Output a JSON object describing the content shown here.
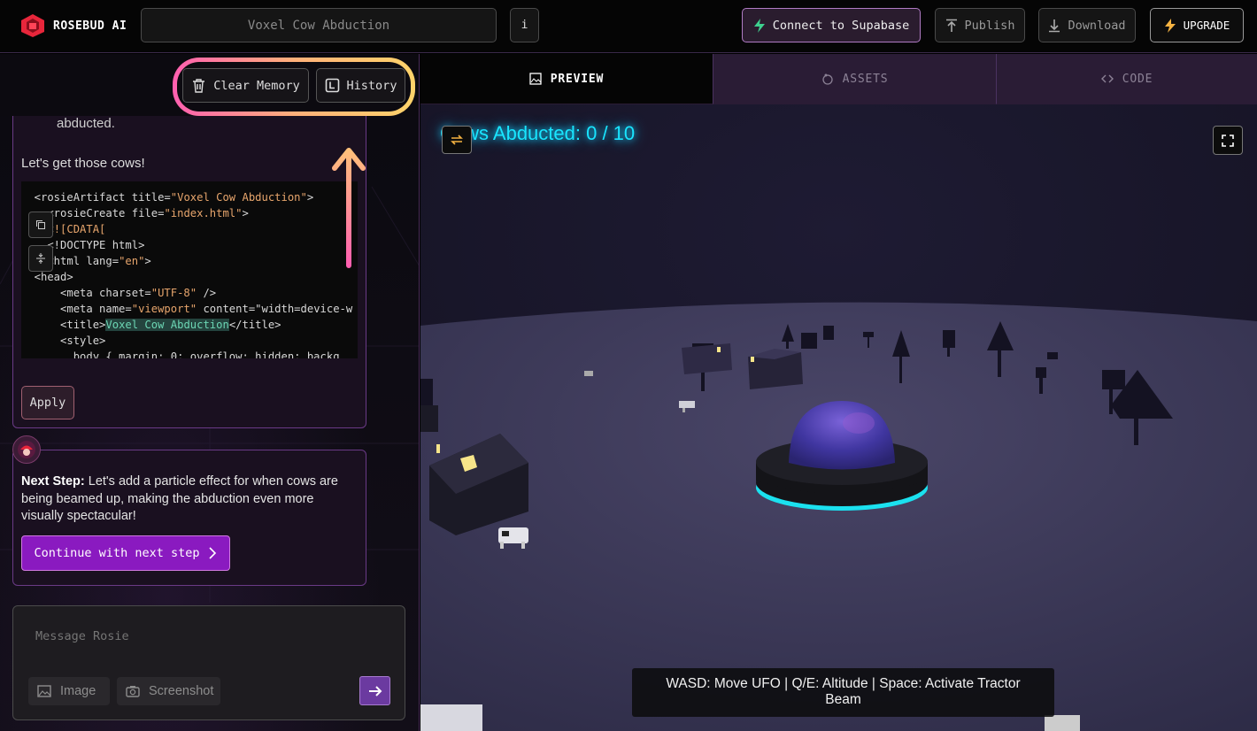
{
  "app": {
    "brand": "ROSEBUD AI",
    "project_title": "Voxel Cow Abduction",
    "info_label": "i"
  },
  "header": {
    "supabase_label": "Connect to Supabase",
    "publish_label": "Publish",
    "download_label": "Download",
    "upgrade_label": "UPGRADE"
  },
  "memory": {
    "clear_label": "Clear Memory",
    "history_label": "History"
  },
  "chat": {
    "abducted_text": "abducted.",
    "cta_text": "Let's get those cows!",
    "code_lines": [
      {
        "pre": "  <rosieArtifact title=",
        "str": "\"Voxel Cow Abduction\"",
        "post": ">"
      },
      {
        "pre": "    <rosieCreate file=",
        "str": "\"index.html\"",
        "post": ">"
      },
      {
        "pre": "    ",
        "str": "<![CDATA[",
        "post": ""
      },
      {
        "pre": "    <!DOCTYPE html>",
        "str": "",
        "post": ""
      },
      {
        "pre": "    <html lang=",
        "str": "\"en\"",
        "post": ">"
      },
      {
        "pre": "  <head>",
        "str": "",
        "post": ""
      },
      {
        "pre": "      <meta charset=",
        "str": "\"UTF-8\"",
        "post": " />"
      },
      {
        "pre": "      <meta name=",
        "str": "\"viewport\"",
        "post": " content=\"width=device-w"
      },
      {
        "pre": "      <title>",
        "hl": "Voxel Cow Abduction",
        "post": "</title>"
      },
      {
        "pre": "      <style>",
        "str": "",
        "post": ""
      },
      {
        "pre": "        body { margin: 0; overflow: hidden; backg",
        "str": "",
        "post": ""
      }
    ],
    "apply_label": "Apply",
    "next_step_heading": "Next Step:",
    "next_step_text": "Let's add a particle effect for when cows are being beamed up, making the abduction even more visually spectacular!",
    "continue_label": "Continue with next step"
  },
  "composer": {
    "placeholder": "Message Rosie",
    "image_label": "Image",
    "screenshot_label": "Screenshot"
  },
  "tabs": [
    {
      "label": "PREVIEW",
      "icon": "image-icon",
      "active": true
    },
    {
      "label": "ASSETS",
      "icon": "assets-icon",
      "active": false
    },
    {
      "label": "CODE",
      "icon": "code-brackets-icon",
      "active": false
    }
  ],
  "preview": {
    "hud_text": "Cows Abducted: 0 / 10",
    "controls_text": "WASD: Move UFO | Q/E: Altitude | Space: Activate Tractor Beam"
  },
  "colors": {
    "accent_purple": "#8a1ac0",
    "hud_cyan": "#19e5ff",
    "highlight_gradient": [
      "#ff5fb0",
      "#ffb07a",
      "#ffd36a"
    ]
  }
}
